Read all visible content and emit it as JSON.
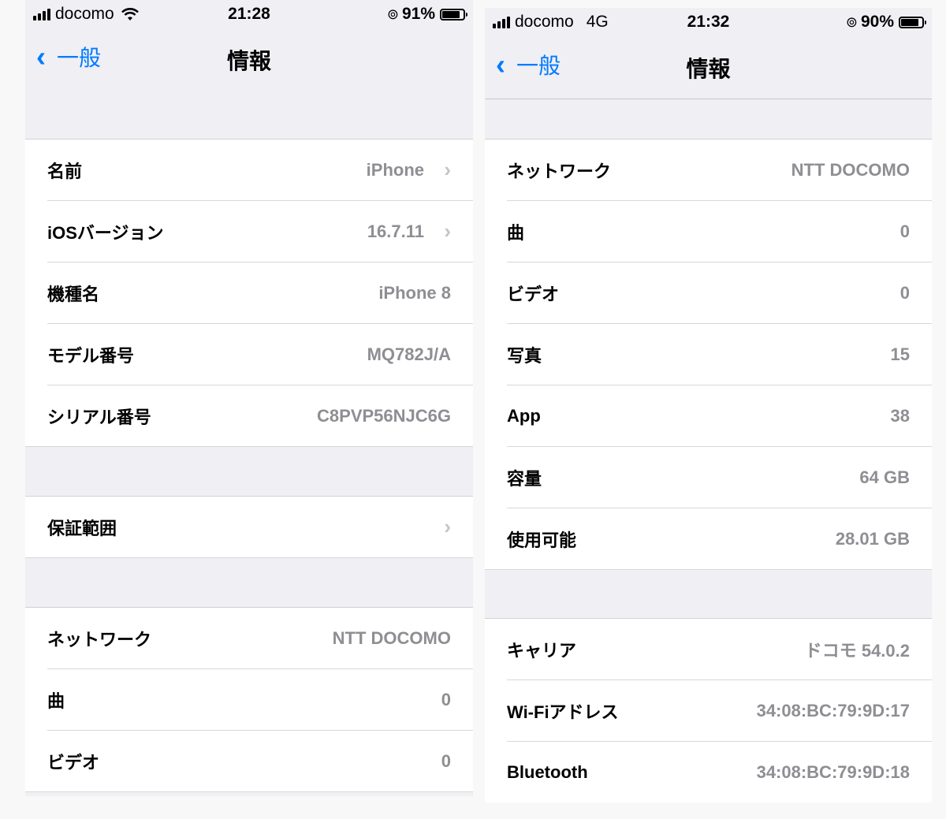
{
  "left": {
    "status": {
      "carrier": "docomo",
      "time": "21:28",
      "battery_text": "91%",
      "battery_level": 0.91,
      "wifi_icon": "wifi-icon"
    },
    "nav": {
      "back_label": "一般",
      "title": "情報"
    },
    "groups": [
      {
        "rows": [
          {
            "label": "名前",
            "value": "iPhone",
            "chevron": true
          },
          {
            "label": "iOSバージョン",
            "value": "16.7.11",
            "chevron": true
          },
          {
            "label": "機種名",
            "value": "iPhone 8",
            "chevron": false
          },
          {
            "label": "モデル番号",
            "value": "MQ782J/A",
            "chevron": false
          },
          {
            "label": "シリアル番号",
            "value": "C8PVP56NJC6G",
            "chevron": false
          }
        ]
      },
      {
        "rows": [
          {
            "label": "保証範囲",
            "value": "",
            "chevron": true
          }
        ]
      },
      {
        "rows": [
          {
            "label": "ネットワーク",
            "value": "NTT DOCOMO",
            "chevron": false
          },
          {
            "label": "曲",
            "value": "0",
            "chevron": false
          },
          {
            "label": "ビデオ",
            "value": "0",
            "chevron": false
          }
        ]
      }
    ]
  },
  "right": {
    "status": {
      "carrier": "docomo",
      "network": "4G",
      "time": "21:32",
      "battery_text": "90%",
      "battery_level": 0.9
    },
    "nav": {
      "back_label": "一般",
      "title": "情報"
    },
    "groups": [
      {
        "rows": [
          {
            "label": "ネットワーク",
            "value": "NTT DOCOMO"
          },
          {
            "label": "曲",
            "value": "0"
          },
          {
            "label": "ビデオ",
            "value": "0"
          },
          {
            "label": "写真",
            "value": "15"
          },
          {
            "label": "App",
            "value": "38"
          },
          {
            "label": "容量",
            "value": "64 GB"
          },
          {
            "label": "使用可能",
            "value": "28.01 GB"
          }
        ]
      },
      {
        "rows": [
          {
            "label": "キャリア",
            "value": "ドコモ 54.0.2"
          },
          {
            "label": "Wi-Fiアドレス",
            "value": "34:08:BC:79:9D:17"
          },
          {
            "label": "Bluetooth",
            "value": "34:08:BC:79:9D:18"
          }
        ]
      }
    ]
  },
  "colors": {
    "accent": "#007aff",
    "secondary_text": "#8e8e93",
    "background": "#efeff4"
  }
}
